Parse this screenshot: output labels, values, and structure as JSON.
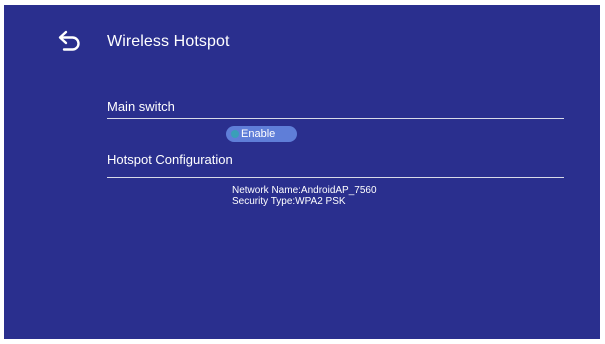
{
  "header": {
    "title": "Wireless Hotspot",
    "back_icon": "back-arrow-icon"
  },
  "main_switch": {
    "label": "Main switch",
    "toggle_label": "Enable",
    "toggle_state": "on",
    "toggle_color": "#5f7ed8"
  },
  "hotspot": {
    "label": "Hotspot Configuration",
    "network_name": "Network Name:AndroidAP_7560",
    "security_type": "Security Type:WPA2 PSK"
  },
  "colors": {
    "background": "#2a2f8e",
    "text": "#ffffff",
    "divider": "#d8dae8"
  }
}
